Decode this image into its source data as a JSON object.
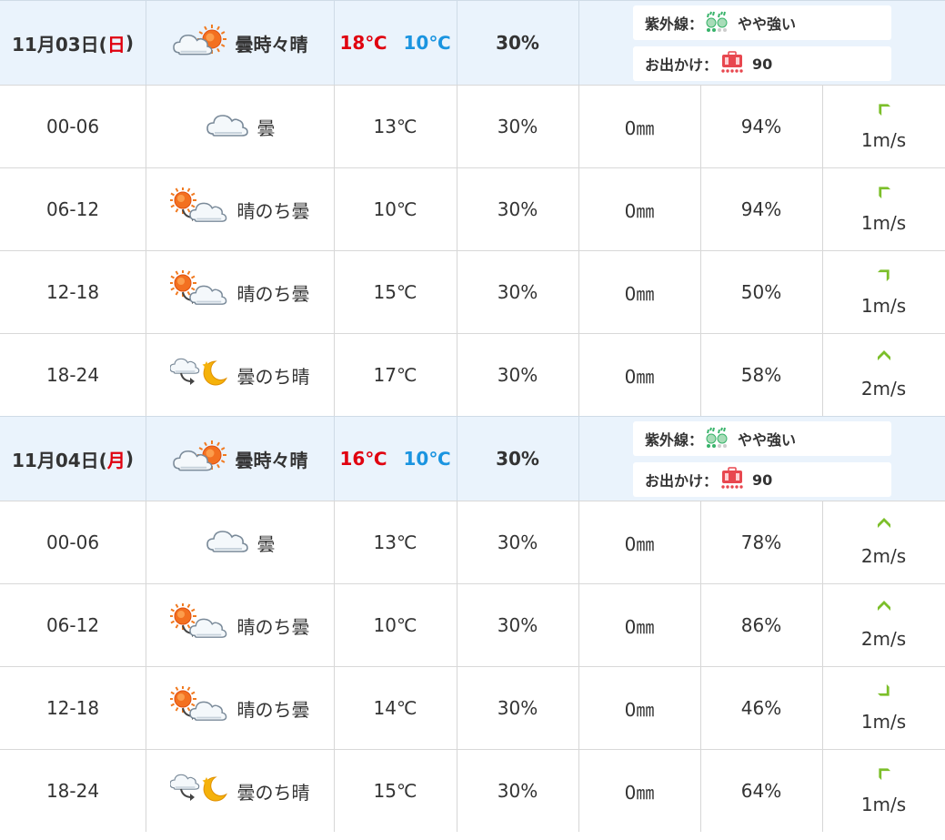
{
  "days": [
    {
      "date_prefix": "11月03日(",
      "dow": "日",
      "date_suffix": ")",
      "weather_icon": "cloudy-sometimes-sunny-icon",
      "weather_label": "曇時々晴",
      "temp_high": "18℃",
      "temp_low": "10℃",
      "rain_chance": "30%",
      "uv_label": "紫外線：",
      "uv_icon": "uv-level-icon",
      "uv_value": "やや強い",
      "outing_label": "お出かけ：",
      "outing_icon": "outing-bag-icon",
      "outing_value": "90",
      "slots": [
        {
          "time": "00-06",
          "icon": "cloud-icon",
          "weather": "曇",
          "temp": "13℃",
          "rain": "30%",
          "precip": "0㎜",
          "humidity": "94%",
          "wind_speed": "1m/s",
          "wind_dir": 135
        },
        {
          "time": "06-12",
          "icon": "sun-then-cloud-icon",
          "weather": "晴のち曇",
          "temp": "10℃",
          "rain": "30%",
          "precip": "0㎜",
          "humidity": "94%",
          "wind_speed": "1m/s",
          "wind_dir": 135
        },
        {
          "time": "12-18",
          "icon": "sun-then-cloud-icon",
          "weather": "晴のち曇",
          "temp": "15℃",
          "rain": "30%",
          "precip": "0㎜",
          "humidity": "50%",
          "wind_speed": "1m/s",
          "wind_dir": 225
        },
        {
          "time": "18-24",
          "icon": "cloud-then-moon-icon",
          "weather": "曇のち晴",
          "temp": "17℃",
          "rain": "30%",
          "precip": "0㎜",
          "humidity": "58%",
          "wind_speed": "2m/s",
          "wind_dir": 180
        }
      ]
    },
    {
      "date_prefix": "11月04日(",
      "dow": "月",
      "date_suffix": ")",
      "weather_icon": "cloudy-sometimes-sunny-icon",
      "weather_label": "曇時々晴",
      "temp_high": "16℃",
      "temp_low": "10℃",
      "rain_chance": "30%",
      "uv_label": "紫外線：",
      "uv_icon": "uv-level-icon",
      "uv_value": "やや強い",
      "outing_label": "お出かけ：",
      "outing_icon": "outing-bag-icon",
      "outing_value": "90",
      "slots": [
        {
          "time": "00-06",
          "icon": "cloud-icon",
          "weather": "曇",
          "temp": "13℃",
          "rain": "30%",
          "precip": "0㎜",
          "humidity": "78%",
          "wind_speed": "2m/s",
          "wind_dir": 180
        },
        {
          "time": "06-12",
          "icon": "sun-then-cloud-icon",
          "weather": "晴のち曇",
          "temp": "10℃",
          "rain": "30%",
          "precip": "0㎜",
          "humidity": "86%",
          "wind_speed": "2m/s",
          "wind_dir": 180
        },
        {
          "time": "12-18",
          "icon": "sun-then-cloud-icon",
          "weather": "晴のち曇",
          "temp": "14℃",
          "rain": "30%",
          "precip": "0㎜",
          "humidity": "46%",
          "wind_speed": "1m/s",
          "wind_dir": 315
        },
        {
          "time": "18-24",
          "icon": "cloud-then-moon-icon",
          "weather": "曇のち晴",
          "temp": "15℃",
          "rain": "30%",
          "precip": "0㎜",
          "humidity": "64%",
          "wind_speed": "1m/s",
          "wind_dir": 135
        }
      ]
    }
  ],
  "colors": {
    "day_row_bg": "#eaf3fc",
    "temp_high": "#e0000f",
    "temp_low": "#1a94e0",
    "sunday_red": "#e0000f",
    "wind_arrow": "#7cbf2a",
    "uv_green": "#38b36a",
    "outing_red": "#e8474f"
  }
}
